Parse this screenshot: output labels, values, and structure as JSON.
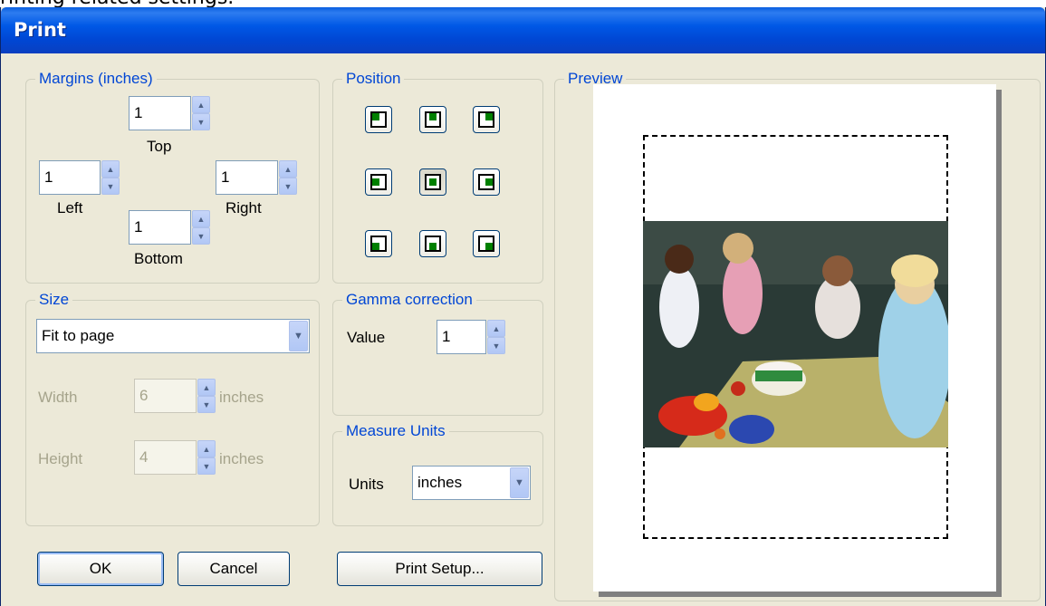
{
  "caption_fragment": "rinting related settings.",
  "window": {
    "title": "Print"
  },
  "margins": {
    "legend": "Margins (inches)",
    "top": {
      "value": "1",
      "label": "Top"
    },
    "left": {
      "value": "1",
      "label": "Left"
    },
    "right": {
      "value": "1",
      "label": "Right"
    },
    "bottom": {
      "value": "1",
      "label": "Bottom"
    }
  },
  "position": {
    "legend": "Position",
    "selected": "center"
  },
  "size": {
    "legend": "Size",
    "mode": "Fit to page",
    "width": {
      "label": "Width",
      "value": "6",
      "unit": "inches"
    },
    "height": {
      "label": "Height",
      "value": "4",
      "unit": "inches"
    }
  },
  "gamma": {
    "legend": "Gamma correction",
    "label": "Value",
    "value": "1"
  },
  "measure": {
    "legend": "Measure Units",
    "label": "Units",
    "value": "inches"
  },
  "preview": {
    "legend": "Preview"
  },
  "buttons": {
    "ok": "OK",
    "cancel": "Cancel",
    "print_setup": "Print Setup..."
  },
  "colors": {
    "titlebar": "#0058e6",
    "dialog_bg": "#ece9d8",
    "legend_text": "#0046d5",
    "position_dot": "#008000"
  }
}
